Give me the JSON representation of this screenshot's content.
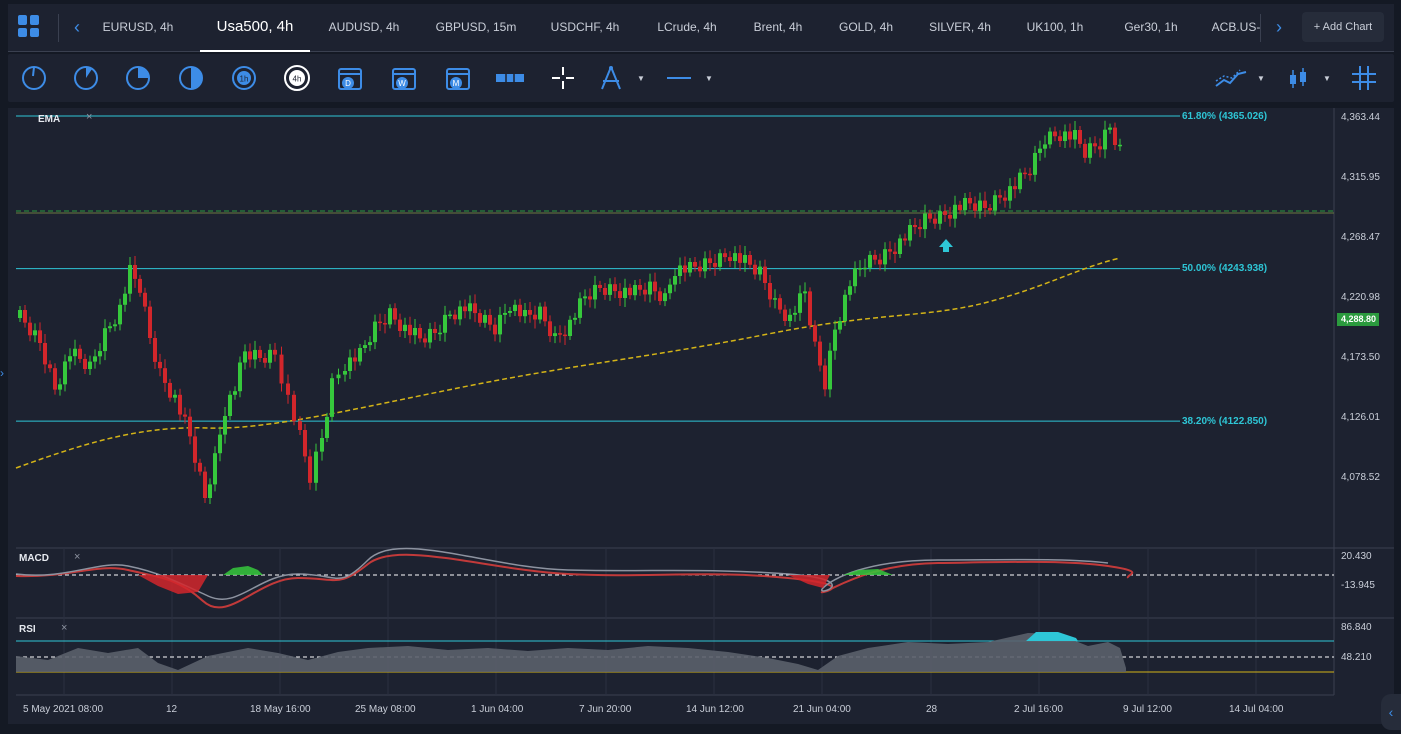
{
  "tabbar": {
    "tabs": [
      {
        "label": "EURUSD, 4h",
        "active": false
      },
      {
        "label": "Usa500, 4h",
        "active": true
      },
      {
        "label": "AUDUSD, 4h",
        "active": false
      },
      {
        "label": "GBPUSD, 15m",
        "active": false
      },
      {
        "label": "USDCHF, 4h",
        "active": false
      },
      {
        "label": "LCrude, 4h",
        "active": false
      },
      {
        "label": "Brent, 4h",
        "active": false
      },
      {
        "label": "GOLD, 4h",
        "active": false
      },
      {
        "label": "SILVER, 4h",
        "active": false
      },
      {
        "label": "UK100, 1h",
        "active": false
      },
      {
        "label": "Ger30, 1h",
        "active": false
      },
      {
        "label": "ACB.US-",
        "active": false
      }
    ],
    "add_chart_label": "+ Add Chart"
  },
  "toolbar": {
    "timeframe_buttons": [
      "1m",
      "5m",
      "15m",
      "30m",
      "1h",
      "4h",
      "D",
      "W",
      "M"
    ],
    "active_timeframe": "4h"
  },
  "main_pane": {
    "indicator_label": "EMA",
    "price_axis": [
      "4,363.44",
      "4,315.95",
      "4,268.47",
      "4,220.98",
      "4,173.50",
      "4,126.01",
      "4,078.52"
    ],
    "current_price": "4,288.80",
    "fib_levels": [
      {
        "label": "61.80% (4365.026)",
        "price": 4365.026
      },
      {
        "label": "50.00% (4243.938)",
        "price": 4243.938
      },
      {
        "label": "38.20% (4122.850)",
        "price": 4122.85
      }
    ]
  },
  "macd_pane": {
    "label": "MACD",
    "axis": [
      "20.430",
      "-13.945"
    ]
  },
  "rsi_pane": {
    "label": "RSI",
    "axis": [
      "86.840",
      "48.210"
    ]
  },
  "time_axis": [
    "5 May 2021 08:00",
    "12",
    "18 May 16:00",
    "25 May 08:00",
    "1 Jun 04:00",
    "7 Jun 20:00",
    "14 Jun 12:00",
    "21 Jun 04:00",
    "28",
    "2 Jul 16:00",
    "9 Jul 12:00",
    "14 Jul 04:00"
  ],
  "colors": {
    "accent": "#3d8ce6",
    "bull": "#36c83c",
    "bear": "#d2262b",
    "fib": "#2ec6d6",
    "ema": "#d4b417",
    "price_tag": "#2b9a3e"
  }
}
